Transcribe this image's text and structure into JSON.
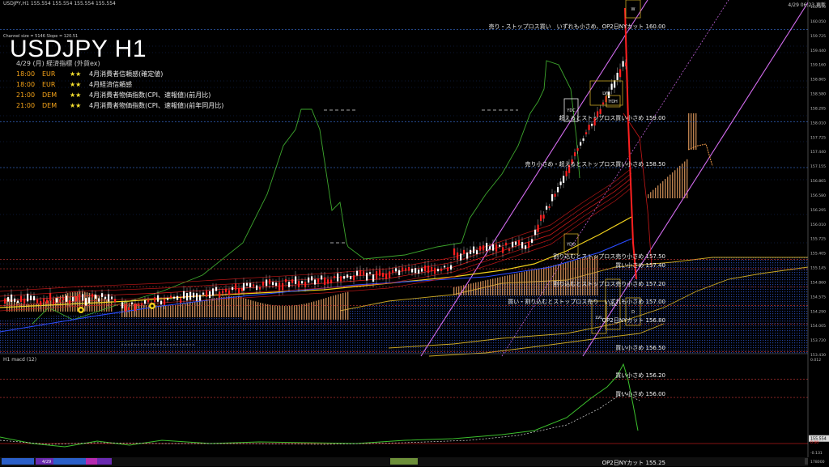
{
  "header": {
    "symbol_line": "USDJPY,H1 155.554 155.554 155.554 155.554",
    "datetime": "4/29 06:23 更新",
    "channel_info": "Channel size = 5146 Slope = 120.51",
    "big_title": "USDJPY H1"
  },
  "calendar": {
    "header": "4/29 (月) 経済指標 (外貨ex)",
    "rows": [
      {
        "time": "18:00",
        "currency": "EUR",
        "stars": "★★",
        "name": "4月消費者信頼感(確定値)"
      },
      {
        "time": "18:00",
        "currency": "EUR",
        "stars": "★★",
        "name": "4月経済信頼感"
      },
      {
        "time": "21:00",
        "currency": "DEM",
        "stars": "★★",
        "name": "4月消費者物価指数(CPI、速報値)(前月比)"
      },
      {
        "time": "21:00",
        "currency": "DEM",
        "stars": "★★",
        "name": "4月消費者物価指数(CPI、速報値)(前年同月比)"
      }
    ]
  },
  "levels": [
    {
      "price": 160.0,
      "label": "売り・ストップロス買い　いずれも小さめ、OP2日NYカット 160.00",
      "color": "#3b6fd6"
    },
    {
      "price": 159.0,
      "label": "超えるとストップロス買い小さめ 159.00",
      "color": "#3b6fd6"
    },
    {
      "price": 158.5,
      "label": "売り小さめ・超えるとストップロス買い小さめ 158.50",
      "color": "#3b6fd6"
    },
    {
      "price": 157.5,
      "label": "割り込むとストップロス売り小さめ 157.50",
      "color": "#d23b3b"
    },
    {
      "price": 157.4,
      "label": "買い小さめ 157.40",
      "color": "#d23b3b"
    },
    {
      "price": 157.2,
      "label": "割り込むとストップロス売り小さめ 157.20",
      "color": "#d23b3b"
    },
    {
      "price": 157.0,
      "label": "買い・割り込むとストップロス売り　いずれも小さめ 157.00",
      "color": "#d23b3b"
    },
    {
      "price": 156.8,
      "label": "OP2日NYカット 156.80",
      "color": "#d23b3b"
    },
    {
      "price": 156.5,
      "label": "買い小さめ 156.50",
      "color": "#d23b3b"
    },
    {
      "price": 156.2,
      "label": "買い小さめ 156.20",
      "color": "#d23b3b"
    },
    {
      "price": 156.0,
      "label": "買い小さめ 156.00",
      "color": "#d23b3b"
    },
    {
      "price": 155.25,
      "label": "OP2日NYカット 155.25",
      "color": "#d23b3b"
    }
  ],
  "price_axis": {
    "ticks": [
      "160.870",
      "160.050",
      "159.725",
      "159.440",
      "159.160",
      "158.865",
      "158.580",
      "158.295",
      "158.010",
      "157.725",
      "157.440",
      "157.155",
      "156.865",
      "156.580",
      "156.295",
      "156.010",
      "155.725",
      "155.405",
      "155.145",
      "154.860",
      "154.575",
      "154.290",
      "154.005",
      "153.720",
      "153.430"
    ],
    "current_price": "155.554"
  },
  "macd": {
    "label": "H1 macd (12)",
    "axis_ticks": [
      "0.012",
      "0.00",
      "-0.131"
    ],
    "volume_tick": "178000"
  },
  "timeline": {
    "date_marker": "4/29"
  },
  "markers": {
    "ydc": "YDC",
    "ydo": "YDO",
    "ydl": "YDL",
    "lvl": "LVL",
    "w": "W",
    "d": "D",
    "lvh": "LVH",
    "ydh": "YDH"
  }
}
